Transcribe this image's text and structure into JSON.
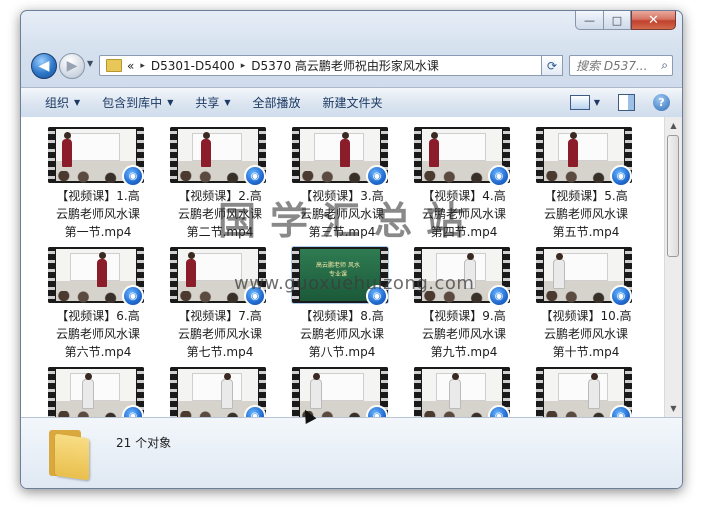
{
  "window": {
    "caption_buttons": {
      "minimize": "—",
      "maximize": "□",
      "close": "✕"
    }
  },
  "nav": {
    "back_symbol": "◀",
    "forward_symbol": "▶",
    "address": {
      "overflow": "«",
      "crumbs": [
        "D5301-D5400",
        "D5370 高云鹏老师祝由形家风水课"
      ],
      "separator": "▸"
    },
    "search_placeholder": "搜索 D537...",
    "search_icon": "magnifier-icon"
  },
  "toolbar": {
    "organize": "组织",
    "include_in_library": "包含到库中",
    "share": "共享",
    "play_all": "全部播放",
    "new_folder": "新建文件夹",
    "help_symbol": "?"
  },
  "files": [
    {
      "line1": "【视频课】1.高",
      "line2": "云鹏老师风水课",
      "line3": "第一节.mp4",
      "thumb": "red-speaker"
    },
    {
      "line1": "【视频课】2.高",
      "line2": "云鹏老师风水课",
      "line3": "第二节.mp4",
      "thumb": "red-speaker"
    },
    {
      "line1": "【视频课】3.高",
      "line2": "云鹏老师风水课",
      "line3": "第三节.mp4",
      "thumb": "red-speaker"
    },
    {
      "line1": "【视频课】4.高",
      "line2": "云鹏老师风水课",
      "line3": "第四节.mp4",
      "thumb": "red-speaker"
    },
    {
      "line1": "【视频课】5.高",
      "line2": "云鹏老师风水课",
      "line3": "第五节.mp4",
      "thumb": "red-speaker"
    },
    {
      "line1": "【视频课】6.高",
      "line2": "云鹏老师风水课",
      "line3": "第六节.mp4",
      "thumb": "red-speaker"
    },
    {
      "line1": "【视频课】7.高",
      "line2": "云鹏老师风水课",
      "line3": "第七节.mp4",
      "thumb": "red-speaker"
    },
    {
      "line1": "【视频课】8.高",
      "line2": "云鹏老师风水课",
      "line3": "第八节.mp4",
      "thumb": "title-card",
      "title_card_text": "高云鹏老师\n风水专业课"
    },
    {
      "line1": "【视频课】9.高",
      "line2": "云鹏老师风水课",
      "line3": "第九节.mp4",
      "thumb": "white-speaker"
    },
    {
      "line1": "【视频课】10.高",
      "line2": "云鹏老师风水课",
      "line3": "第十节.mp4",
      "thumb": "white-speaker"
    },
    {
      "thumb": "white-speaker"
    },
    {
      "thumb": "white-speaker"
    },
    {
      "thumb": "white-speaker"
    },
    {
      "thumb": "white-speaker"
    },
    {
      "thumb": "white-speaker"
    }
  ],
  "watermark": {
    "line1": "国学汇总站",
    "line2": "www.guoxuehuizong.com"
  },
  "details": {
    "count_text": "21 个对象"
  },
  "colors": {
    "accent": "#1f6ad0",
    "toolbar_text": "#1c3a63"
  }
}
